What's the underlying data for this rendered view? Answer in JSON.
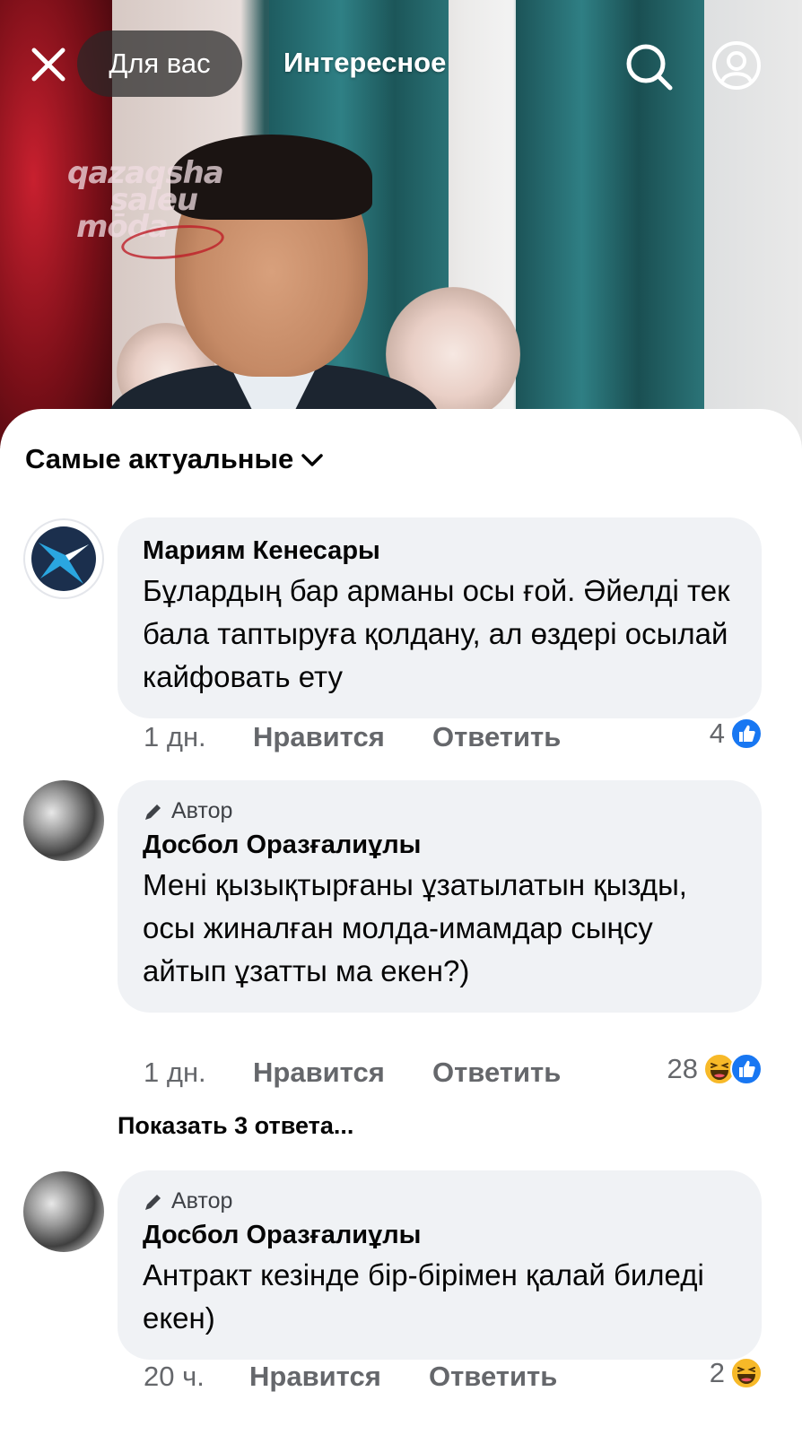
{
  "topbar": {
    "tab_for_you": "Для вас",
    "tab_interesting": "Интересное"
  },
  "video": {
    "watermark_lines": [
      "qazaqsha",
      "saleu",
      "mōda"
    ]
  },
  "sort": {
    "label": "Самые актуальные"
  },
  "comments": [
    {
      "name": "Мариям Кенесары",
      "is_author": false,
      "text": "Бұлардың бар арманы осы ғой. Әйелді тек бала таптыруға қолдану, ал өздері осылай кайфовать ету",
      "time": "1 дн.",
      "like_label": "Нравится",
      "reply_label": "Ответить",
      "reaction_count": "4",
      "reactions": [
        "like"
      ]
    },
    {
      "name": "Досбол Оразғалиұлы",
      "is_author": true,
      "author_label": "Автор",
      "text": "Мені қызықтырғаны ұзатылатын қызды, осы жиналған молда-имамдар сыңсу айтып ұзатты ма екен?)",
      "time": "1 дн.",
      "like_label": "Нравится",
      "reply_label": "Ответить",
      "reaction_count": "28",
      "reactions": [
        "haha",
        "like"
      ],
      "show_replies": "Показать 3 ответа..."
    },
    {
      "name": "Досбол Оразғалиұлы",
      "is_author": true,
      "author_label": "Автор",
      "text": "Антракт кезінде бір-бірімен қалай биледі екен)",
      "time": "20 ч.",
      "like_label": "Нравится",
      "reply_label": "Ответить",
      "reaction_count": "2",
      "reactions": [
        "haha"
      ]
    }
  ],
  "colors": {
    "like_blue": "#1877f2",
    "haha_yellow": "#f7b928",
    "bubble_bg": "#f0f2f5",
    "meta_gray": "#65676b"
  }
}
